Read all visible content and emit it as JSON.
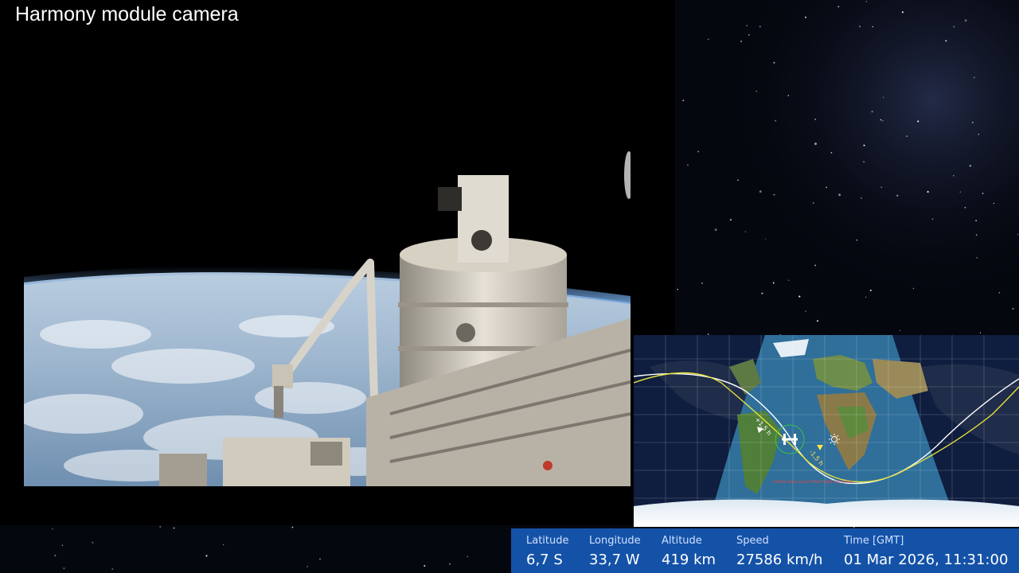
{
  "camera": {
    "title": "Harmony module camera"
  },
  "map": {
    "annotation_minus": "-1,5 h",
    "annotation_plus": "+1,5 h",
    "footnote": "Orbital data source ESA Flight Dynamics"
  },
  "telemetry": {
    "latitude": {
      "label": "Latitude",
      "value": "6,7 S"
    },
    "longitude": {
      "label": "Longitude",
      "value": "33,7 W"
    },
    "altitude": {
      "label": "Altitude",
      "value": "419 km"
    },
    "speed": {
      "label": "Speed",
      "value": "27586 km/h"
    },
    "time": {
      "label": "Time [GMT]",
      "value": "01 Mar 2026, 11:31:00"
    }
  },
  "colors": {
    "info_bar": "#1452a8",
    "ground_track_current": "#ffffff",
    "ground_track_next": "#e6e23a",
    "ocean_day": "#2f6f9a",
    "night_side": "#0f1d3f"
  },
  "icons": [
    "sun-icon",
    "iss-icon"
  ]
}
